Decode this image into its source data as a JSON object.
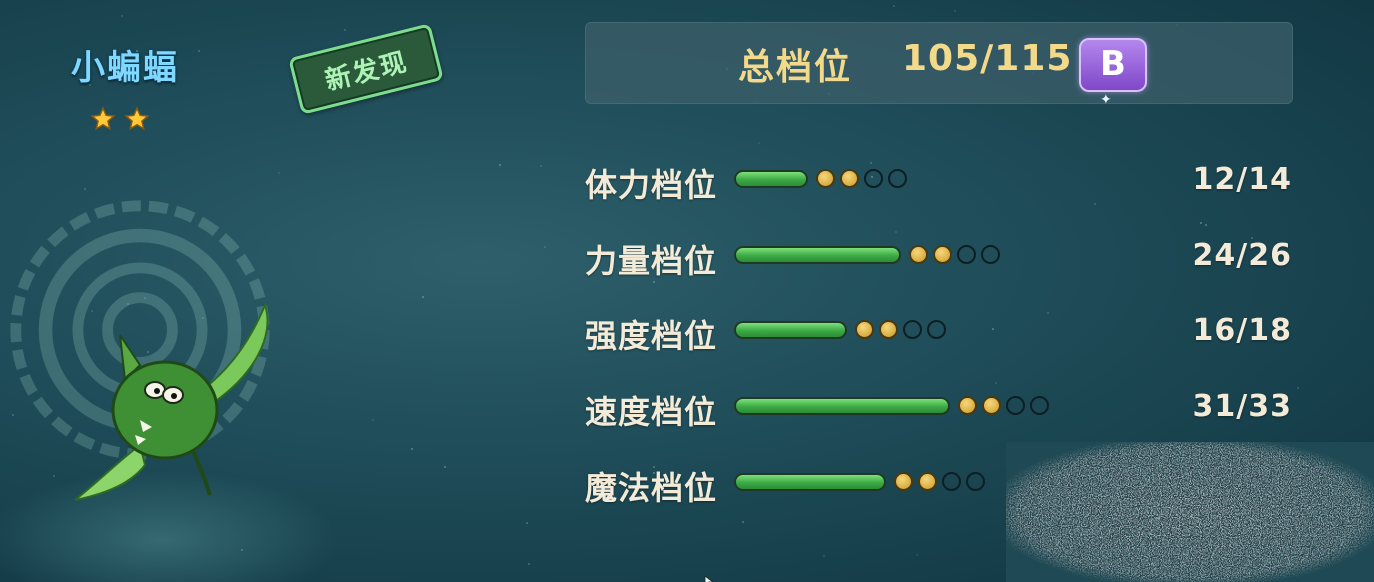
{
  "pet": {
    "name": "小蝙蝠",
    "stars": 2,
    "new_badge": "新发现"
  },
  "total": {
    "label": "总档位",
    "value": "105/115",
    "grade": "B"
  },
  "stats": [
    {
      "label": "体力档位",
      "value": "12/14",
      "bar_fill": 0.3,
      "dots_filled": 2,
      "dots_total": 4
    },
    {
      "label": "力量档位",
      "value": "24/26",
      "bar_fill": 0.68,
      "dots_filled": 2,
      "dots_total": 4
    },
    {
      "label": "强度档位",
      "value": "16/18",
      "bar_fill": 0.46,
      "dots_filled": 2,
      "dots_total": 4
    },
    {
      "label": "速度档位",
      "value": "31/33",
      "bar_fill": 0.88,
      "dots_filled": 2,
      "dots_total": 4
    },
    {
      "label": "魔法档位",
      "value": "",
      "bar_fill": 0.62,
      "dots_filled": 2,
      "dots_total": 4
    }
  ],
  "colors": {
    "name": "#7fd8ff",
    "gold_text": "#f3d98a",
    "grade_purple": "#9a62dc",
    "bar_green": "#3caa45"
  },
  "icons": [
    "star-icon",
    "sparkle-icon",
    "pet-bat-sprite",
    "grade-b-badge"
  ]
}
